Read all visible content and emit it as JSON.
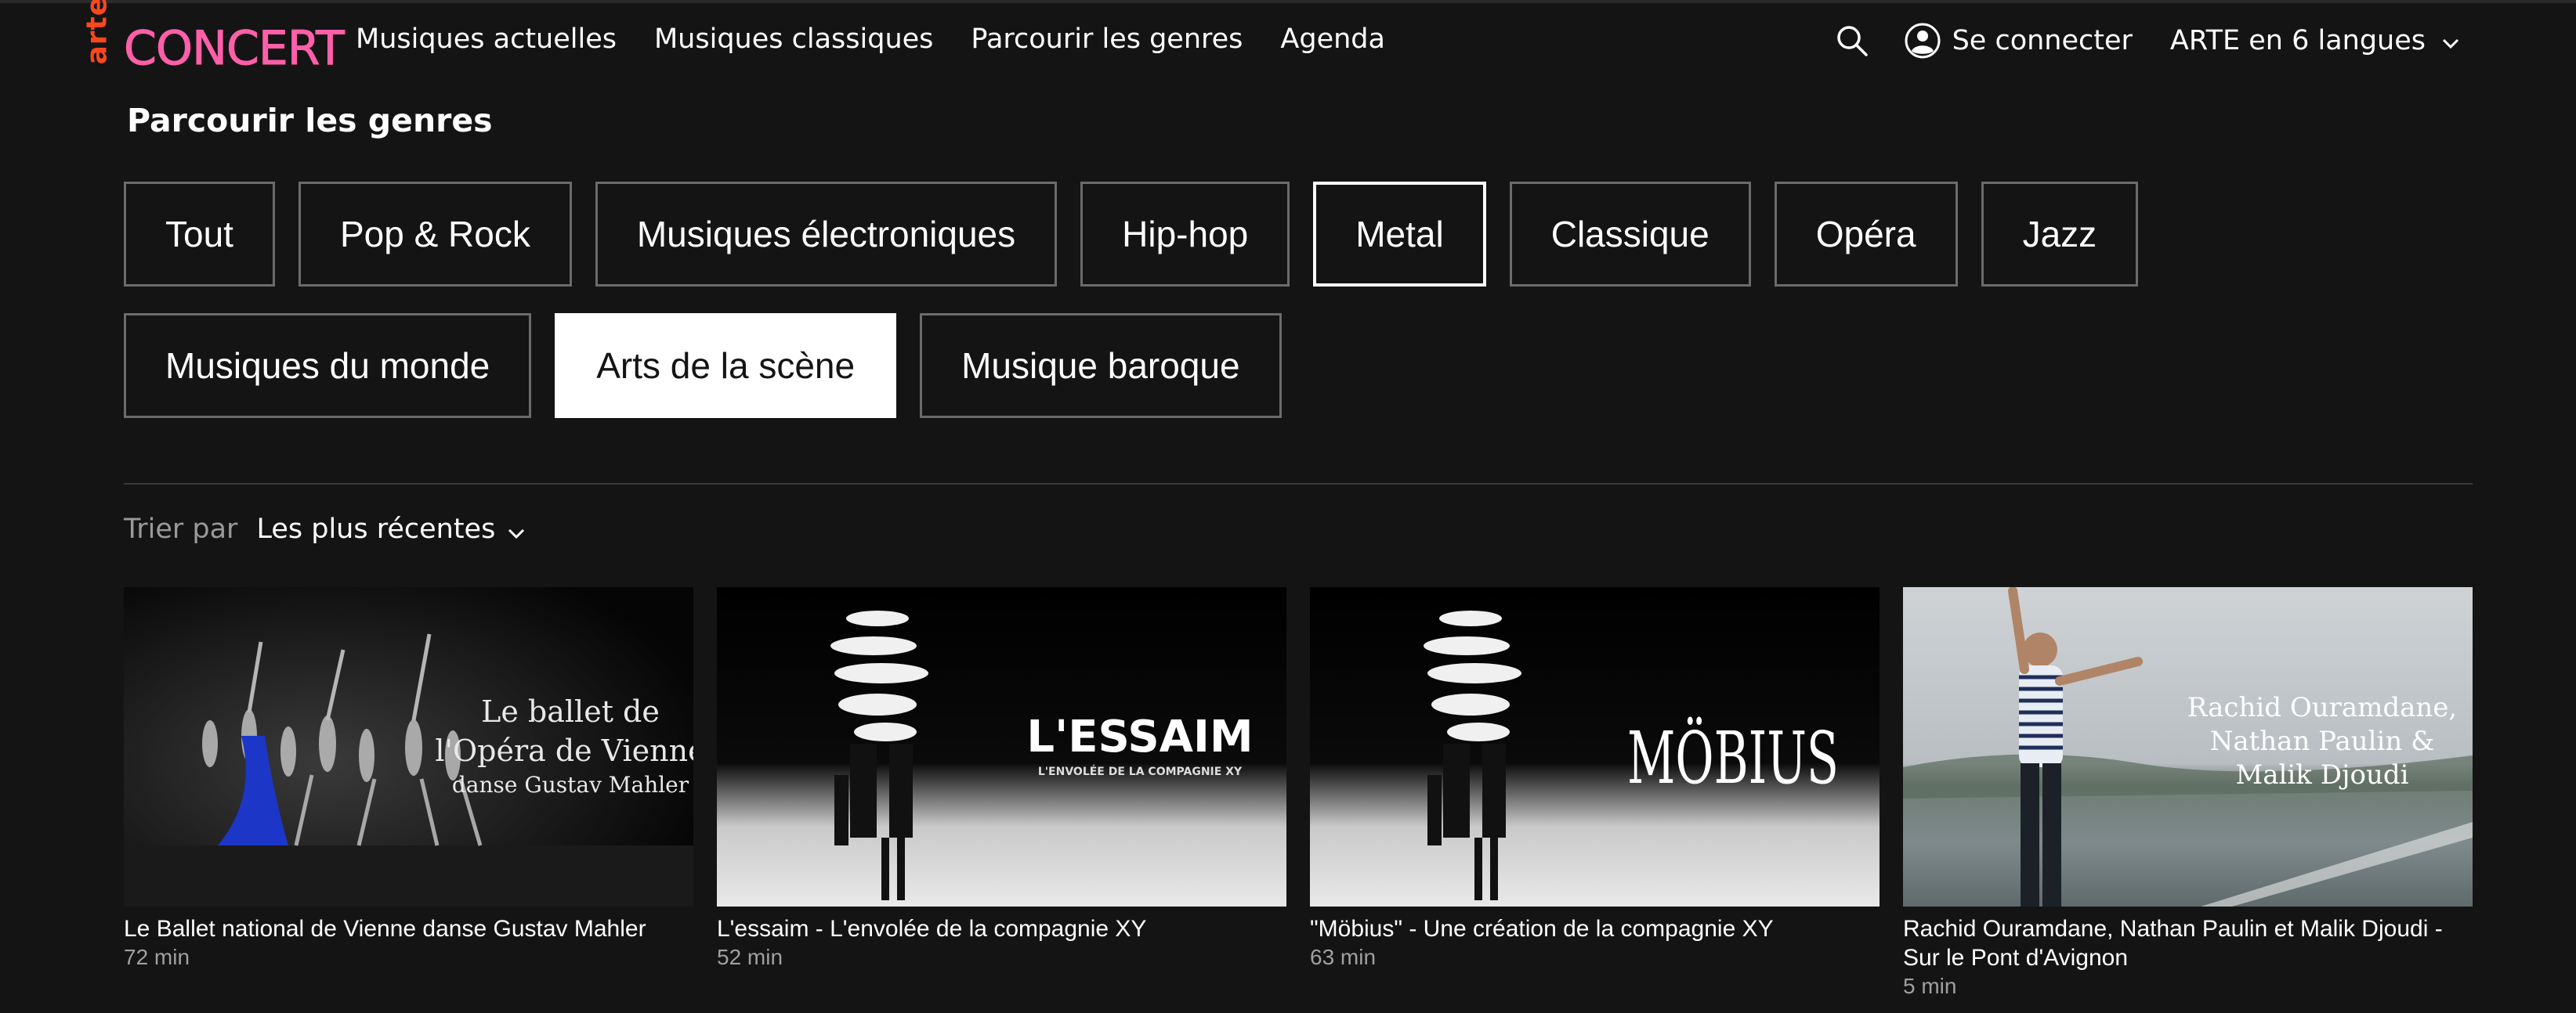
{
  "brand": {
    "arte": "arte",
    "concert": "CONCERT",
    "concert_color": "#ff5fa8",
    "arte_color": "#fa481c"
  },
  "nav": {
    "items": [
      {
        "label": "Musiques actuelles"
      },
      {
        "label": "Musiques classiques"
      },
      {
        "label": "Parcourir les genres"
      },
      {
        "label": "Agenda"
      }
    ]
  },
  "header": {
    "search_icon": "search-icon",
    "login_label": "Se connecter",
    "login_icon": "user-icon",
    "language_label": "ARTE en 6 langues"
  },
  "genres": {
    "title": "Parcourir les genres",
    "row1": [
      {
        "label": "Tout",
        "state": "default"
      },
      {
        "label": "Pop & Rock",
        "state": "default"
      },
      {
        "label": "Musiques électroniques",
        "state": "default"
      },
      {
        "label": "Hip-hop",
        "state": "default"
      },
      {
        "label": "Metal",
        "state": "outlined"
      },
      {
        "label": "Classique",
        "state": "default"
      },
      {
        "label": "Opéra",
        "state": "default"
      },
      {
        "label": "Jazz",
        "state": "default"
      }
    ],
    "row2": [
      {
        "label": "Musiques du monde",
        "state": "default"
      },
      {
        "label": "Arts de la scène",
        "state": "selected"
      },
      {
        "label": "Musique baroque",
        "state": "default"
      }
    ]
  },
  "sort": {
    "label": "Trier par",
    "value": "Les plus récentes"
  },
  "cards": [
    {
      "title": "Le Ballet national de Vienne danse Gustav Mahler",
      "duration": "72 min",
      "overlay_lines": [
        "Le ballet de",
        "l'Opéra de Vienne",
        "danse Gustav Mahler"
      ]
    },
    {
      "title": "L'essaim - L'envolée de la compagnie XY",
      "duration": "52 min",
      "overlay_title": "L'ESSAIM",
      "overlay_subtitle": "L'ENVOLÉE DE LA COMPAGNIE XY"
    },
    {
      "title": "\"Möbius\" - Une création de la compagnie XY",
      "duration": "63 min",
      "overlay_title": "MÖBIUS"
    },
    {
      "title": "Rachid Ouramdane, Nathan Paulin et Malik Djoudi - Sur le Pont d'Avignon",
      "duration": "5 min",
      "overlay_lines": [
        "Rachid Ouramdane,",
        "Nathan Paulin &",
        "Malik Djoudi"
      ]
    }
  ]
}
